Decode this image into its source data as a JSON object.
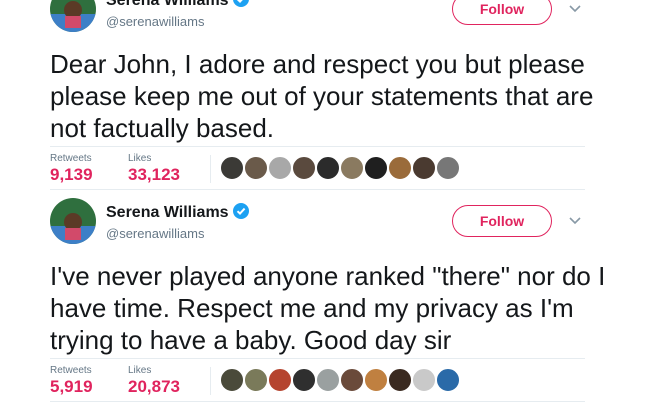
{
  "tweets": [
    {
      "name": "Serena Williams",
      "handle": "@serenawilliams",
      "follow_label": "Follow",
      "text": "Dear John, I adore and respect you but please please keep me out of your statements that are not factually based.",
      "retweets_label": "Retweets",
      "retweets": "9,139",
      "likes_label": "Likes",
      "likes": "33,123",
      "likers": [
        "liker-avatar",
        "liker-avatar",
        "liker-avatar",
        "liker-avatar",
        "liker-avatar",
        "liker-avatar",
        "liker-avatar",
        "liker-avatar",
        "liker-avatar",
        "liker-avatar"
      ]
    },
    {
      "name": "Serena Williams",
      "handle": "@serenawilliams",
      "follow_label": "Follow",
      "text": "I've never played anyone ranked \"there\" nor do I have time. Respect me and my privacy as I'm trying to have a baby. Good day sir",
      "retweets_label": "Retweets",
      "retweets": "5,919",
      "likes_label": "Likes",
      "likes": "20,873",
      "likers": [
        "liker-avatar",
        "liker-avatar",
        "liker-avatar",
        "liker-avatar",
        "liker-avatar",
        "liker-avatar",
        "liker-avatar",
        "liker-avatar",
        "liker-avatar",
        "liker-avatar"
      ]
    }
  ],
  "colors": {
    "accent": "#e0245e",
    "verified": "#1da1f2",
    "secondary_text": "#657786",
    "divider": "#e6ecf0"
  },
  "liker_colors_1": [
    "#3b3a36",
    "#6a5a4a",
    "#a8a8a8",
    "#5a4a3e",
    "#2b2b2b",
    "#8a7a60",
    "#1f1f1f",
    "#9a6b3a",
    "#4a3a30",
    "#777777"
  ],
  "liker_colors_2": [
    "#4a4a3a",
    "#7a7a5a",
    "#b5442f",
    "#2f2f2f",
    "#9aa0a0",
    "#6a4a3a",
    "#c08040",
    "#3a2a20",
    "#c9c9c9",
    "#2a6aa8"
  ]
}
